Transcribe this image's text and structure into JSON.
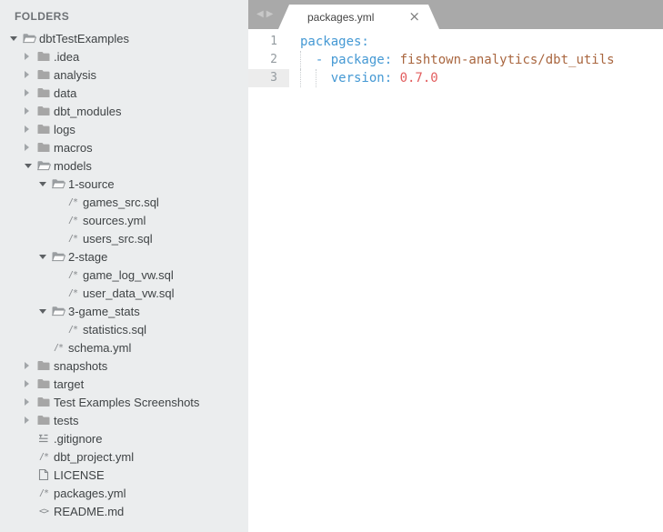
{
  "colors": {
    "sidebar_bg": "#ebedee",
    "tabbar_bg": "#a9a9a9",
    "editor_bg": "#ffffff",
    "current_line_gutter": "#ececec",
    "yaml_key_blue": "#4599d4",
    "yaml_string_brown": "#a9663f",
    "yaml_number_red": "#e25d5e",
    "folder_icon_gray": "#a6a6a6"
  },
  "icons": {
    "code_file": "/*",
    "markup_file": "<>",
    "nav_back": "◀",
    "nav_forward": "▶",
    "chevron_expanded": "css-triangle-down",
    "chevron_collapsed": "css-triangle-right"
  },
  "sidebar": {
    "header": "FOLDERS",
    "items": [
      {
        "label": "dbtTestExamples",
        "level": 0,
        "type": "folder",
        "state": "expanded"
      },
      {
        "label": ".idea",
        "level": 1,
        "type": "folder",
        "state": "collapsed"
      },
      {
        "label": "analysis",
        "level": 1,
        "type": "folder",
        "state": "collapsed"
      },
      {
        "label": "data",
        "level": 1,
        "type": "folder",
        "state": "collapsed"
      },
      {
        "label": "dbt_modules",
        "level": 1,
        "type": "folder",
        "state": "collapsed"
      },
      {
        "label": "logs",
        "level": 1,
        "type": "folder",
        "state": "collapsed"
      },
      {
        "label": "macros",
        "level": 1,
        "type": "folder",
        "state": "collapsed"
      },
      {
        "label": "models",
        "level": 1,
        "type": "folder",
        "state": "expanded"
      },
      {
        "label": "1-source",
        "level": 2,
        "type": "folder",
        "state": "expanded"
      },
      {
        "label": "games_src.sql",
        "level": 3,
        "type": "file",
        "icon": "code_file"
      },
      {
        "label": "sources.yml",
        "level": 3,
        "type": "file",
        "icon": "code_file"
      },
      {
        "label": "users_src.sql",
        "level": 3,
        "type": "file",
        "icon": "code_file"
      },
      {
        "label": "2-stage",
        "level": 2,
        "type": "folder",
        "state": "expanded"
      },
      {
        "label": "game_log_vw.sql",
        "level": 3,
        "type": "file",
        "icon": "code_file"
      },
      {
        "label": "user_data_vw.sql",
        "level": 3,
        "type": "file",
        "icon": "code_file"
      },
      {
        "label": "3-game_stats",
        "level": 2,
        "type": "folder",
        "state": "expanded"
      },
      {
        "label": "statistics.sql",
        "level": 3,
        "type": "file",
        "icon": "code_file"
      },
      {
        "label": "schema.yml",
        "level": 2,
        "type": "file",
        "icon": "code_file"
      },
      {
        "label": "snapshots",
        "level": 1,
        "type": "folder",
        "state": "collapsed"
      },
      {
        "label": "target",
        "level": 1,
        "type": "folder",
        "state": "collapsed"
      },
      {
        "label": "Test Examples Screenshots",
        "level": 1,
        "type": "folder",
        "state": "collapsed"
      },
      {
        "label": "tests",
        "level": 1,
        "type": "folder",
        "state": "collapsed"
      },
      {
        "label": ".gitignore",
        "level": 1,
        "type": "file",
        "icon": "text_file"
      },
      {
        "label": "dbt_project.yml",
        "level": 1,
        "type": "file",
        "icon": "code_file"
      },
      {
        "label": "LICENSE",
        "level": 1,
        "type": "file",
        "icon": "plain_file"
      },
      {
        "label": "packages.yml",
        "level": 1,
        "type": "file",
        "icon": "code_file"
      },
      {
        "label": "README.md",
        "level": 1,
        "type": "file",
        "icon": "markup_file"
      }
    ]
  },
  "tabbar": {
    "nav_back": "◀",
    "nav_forward": "▶",
    "tabs": [
      {
        "label": "packages.yml",
        "close_glyph": "×",
        "active": true
      }
    ]
  },
  "editor": {
    "language": "yaml",
    "lines": [
      {
        "number": "1",
        "current": false,
        "tokens": [
          {
            "text": "packages:",
            "type": "key"
          }
        ]
      },
      {
        "number": "2",
        "current": false,
        "tokens": [
          {
            "text": "  - package: ",
            "type": "key"
          },
          {
            "text": "fishtown-analytics/dbt_utils",
            "type": "string"
          }
        ]
      },
      {
        "number": "3",
        "current": true,
        "tokens": [
          {
            "text": "    version: ",
            "type": "key"
          },
          {
            "text": "0.7.0",
            "type": "number"
          }
        ]
      }
    ]
  }
}
